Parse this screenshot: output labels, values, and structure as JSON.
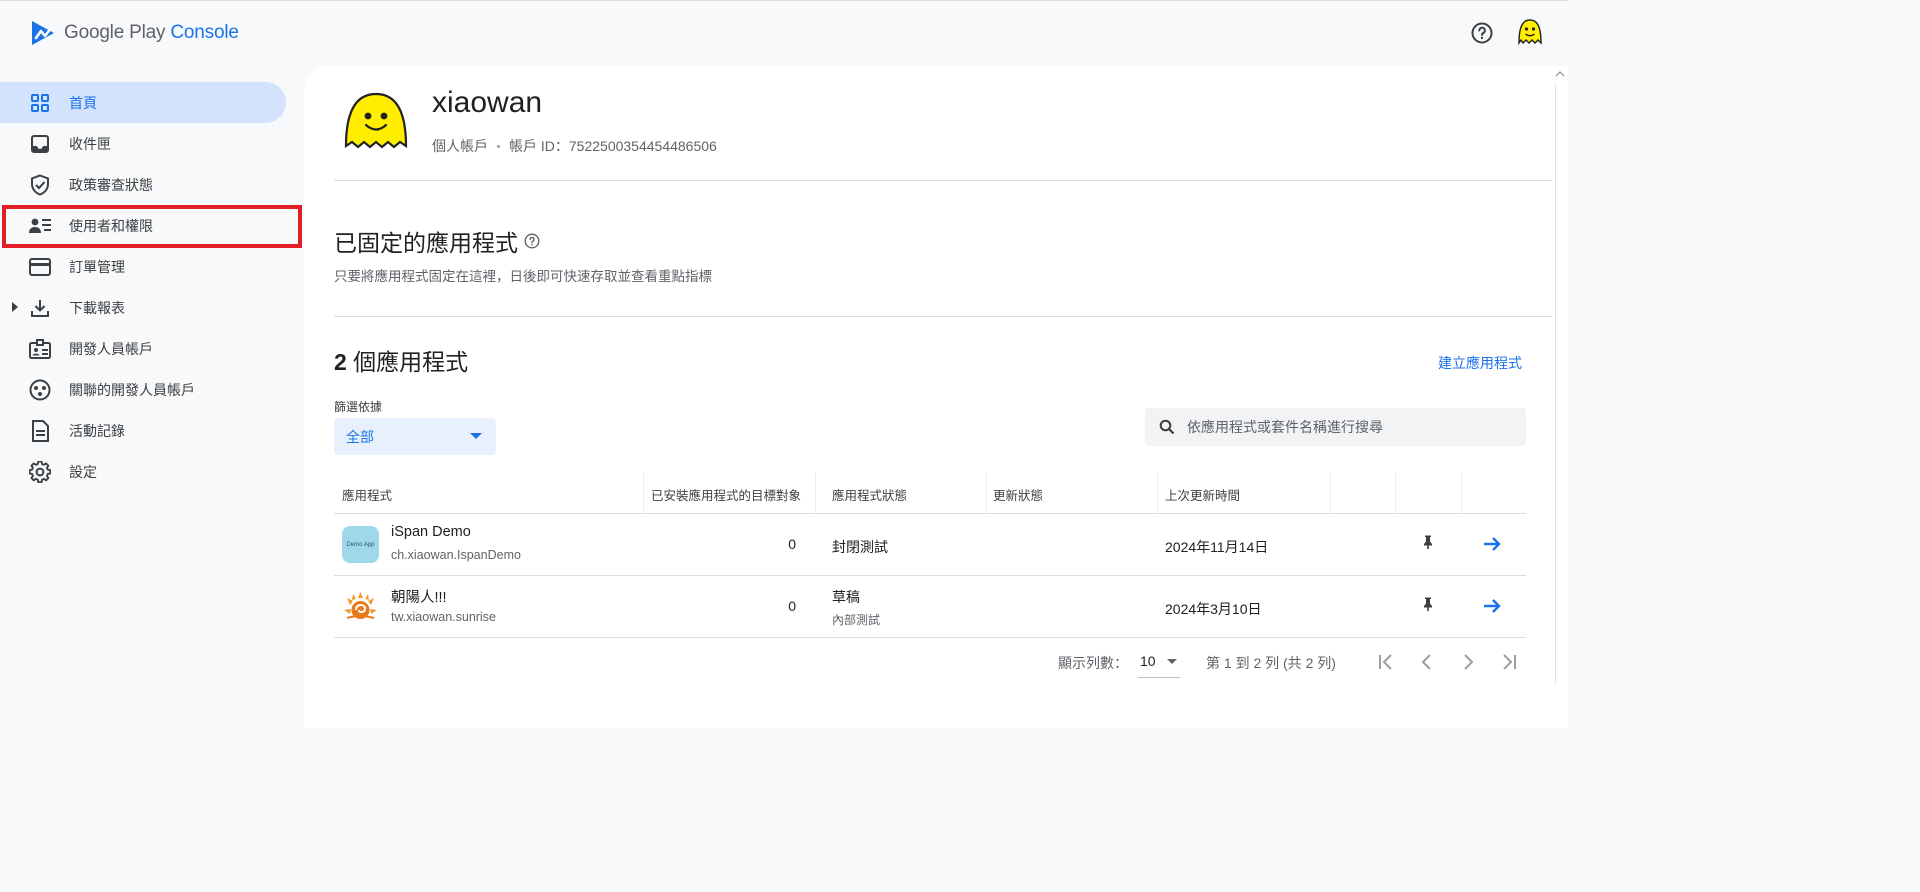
{
  "header": {
    "logo_google": "Google Play",
    "logo_console": "Console"
  },
  "sidebar": {
    "items": [
      {
        "label": "首頁",
        "icon": "dashboard-icon",
        "active": true
      },
      {
        "label": "收件匣",
        "icon": "inbox-icon"
      },
      {
        "label": "政策審查狀態",
        "icon": "shield-check-icon"
      },
      {
        "label": "使用者和權限",
        "icon": "users-permissions-icon",
        "highlighted": true
      },
      {
        "label": "訂單管理",
        "icon": "credit-card-icon"
      },
      {
        "label": "下載報表",
        "icon": "download-icon",
        "expandable": true
      },
      {
        "label": "開發人員帳戶",
        "icon": "badge-icon"
      },
      {
        "label": "關聯的開發人員帳戶",
        "icon": "linked-accounts-icon"
      },
      {
        "label": "活動記錄",
        "icon": "document-icon"
      },
      {
        "label": "設定",
        "icon": "gear-icon"
      }
    ]
  },
  "account": {
    "name": "xiaowan",
    "type": "個人帳戶",
    "id_text": "帳戶 ID：7522500354454486506"
  },
  "pinned": {
    "title": "已固定的應用程式",
    "subtitle": "只要將應用程式固定在這裡，日後即可快速存取並查看重點指標"
  },
  "apps": {
    "count": "2",
    "count_suffix": " 個應用程式",
    "create_label": "建立應用程式",
    "filter_label": "篩選依據",
    "filter_value": "全部",
    "search_placeholder": "依應用程式或套件名稱進行搜尋",
    "columns": [
      "應用程式",
      "已安裝應用程式的目標對象",
      "應用程式狀態",
      "更新狀態",
      "上次更新時間"
    ],
    "rows": [
      {
        "name": "iSpan Demo",
        "package": "ch.xiaowan.IspanDemo",
        "icon_text": "Demo App",
        "installs": "0",
        "status": "封閉測試",
        "status_sub": "",
        "updated": "2024年11月14日"
      },
      {
        "name": "朝陽人!!!",
        "package": "tw.xiaowan.sunrise",
        "icon_text": "",
        "installs": "0",
        "status": "草稿",
        "status_sub": "內部測試",
        "updated": "2024年3月10日"
      }
    ]
  },
  "pagination": {
    "rows_label": "顯示列數：",
    "rows_value": "10",
    "range_text": "第 1 到 2 列 (共 2 列)"
  },
  "colors": {
    "accent": "#1a73e8",
    "active_nav_bg": "#d3e3fd",
    "highlight_border": "#e21f26"
  }
}
